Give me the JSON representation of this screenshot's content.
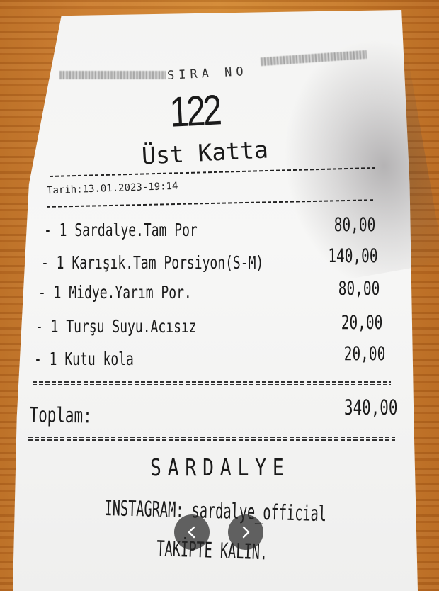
{
  "receipt": {
    "header_label": "SIRA NO",
    "queue_number": "122",
    "floor_note": "Üst Katta",
    "date_line": "Tarih:13.01.2023-19:14",
    "items": [
      {
        "line": "- 1 Sardalye.Tam Por",
        "price": "80,00"
      },
      {
        "line": "- 1 Karışık.Tam Porsiyon(S-M)",
        "price": "140,00"
      },
      {
        "line": "- 1 Midye.Yarım Por.",
        "price": "80,00"
      },
      {
        "line": "- 1 Turşu Suyu.Acısız",
        "price": "20,00"
      },
      {
        "line": "- 1 Kutu kola",
        "price": "20,00"
      }
    ],
    "total_label": "Toplam:",
    "total_value": "340,00",
    "brand": "SARDALYE",
    "instagram": "INSTAGRAM: sardalye_official",
    "follow_text": "TAKİPTE KALIN."
  },
  "viewer": {
    "prev_icon": "chevron-left-icon",
    "next_icon": "chevron-right-icon"
  }
}
